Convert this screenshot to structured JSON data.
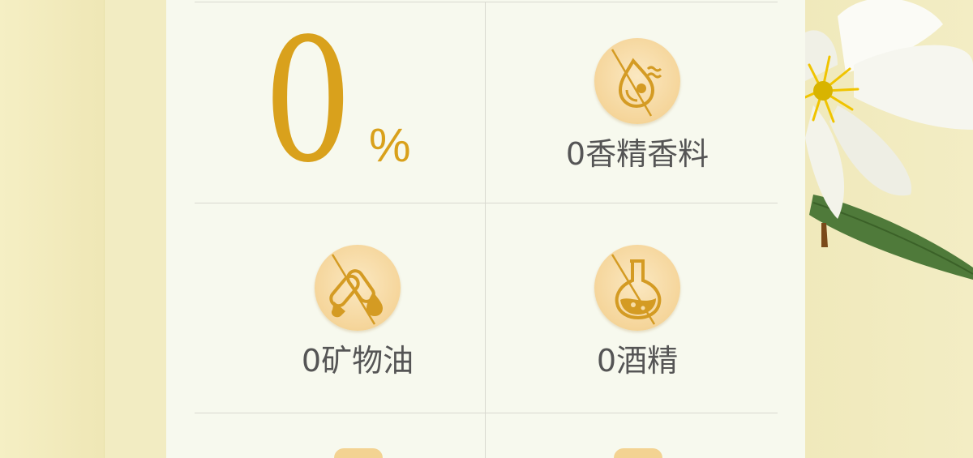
{
  "highlight": {
    "number": "0",
    "unit": "%"
  },
  "features": [
    {
      "label": "0香精香料",
      "icon": "no-fragrance-icon"
    },
    {
      "label": "0矿物油",
      "icon": "no-mineral-oil-icon"
    },
    {
      "label": "0酒精",
      "icon": "no-alcohol-icon"
    }
  ],
  "colors": {
    "accent": "#d9a11c",
    "badge": "#f5d59a",
    "card": "#f7f9ee",
    "text": "#555555"
  }
}
